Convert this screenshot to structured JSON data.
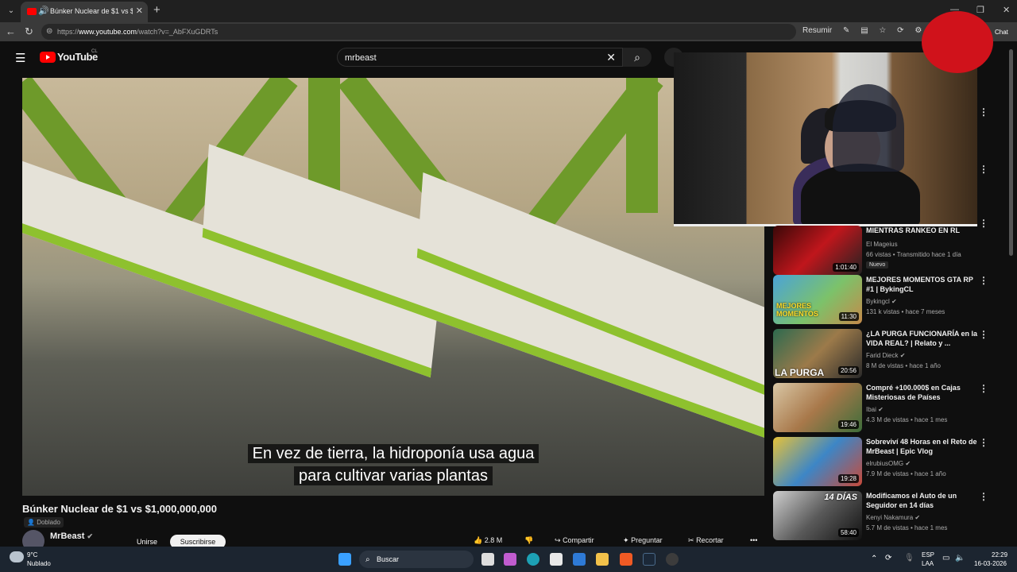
{
  "browser": {
    "tab_title": "Búnker Nuclear de $1 vs $1.0",
    "url_prefix": "https://",
    "url_host": "www.youtube.com",
    "url_path": "/watch?v=_AbFXuGDRTs",
    "resumir_label": "Resumir",
    "chat_label": "Chat"
  },
  "youtube": {
    "brand": "YouTube",
    "country": "CL",
    "search_query": "mrbeast"
  },
  "video": {
    "caption_line1": "En vez de tierra, la hidroponía usa agua",
    "caption_line2": "para cultivar varias plantas",
    "title": "Búnker Nuclear de $1 vs $1,000,000,000",
    "dub_label": "Doblado",
    "channel": "MrBeast",
    "join_label": "Unirse",
    "subscribe_label": "Suscribirse",
    "likes": "2.8 M",
    "share_label": "Compartir",
    "ask_label": "Preguntar",
    "clip_label": "Recortar"
  },
  "recommendations": [
    {
      "title": "MIENTRAS RANKEO EN RL",
      "channel": "El Mageius",
      "meta": "66 vistas • Transmitido hace 1 día",
      "badge": "Nuevo",
      "duration": "1:01:40"
    },
    {
      "title": "MEJORES MOMENTOS GTA RP #1 | BykingCL",
      "channel": "Bykingcl",
      "meta": "131 k vistas • hace 7 meses",
      "duration": "11:30"
    },
    {
      "title": "¿LA PURGA FUNCIONARÍA en la VIDA REAL? | Relato y ...",
      "channel": "Farid Dieck",
      "meta": "8 M de vistas • hace 1 año",
      "duration": "20:56"
    },
    {
      "title": "Compré +100.000$ en Cajas Misteriosas de Países",
      "channel": "Ibai",
      "meta": "4.3 M de vistas • hace 1 mes",
      "duration": "19:46"
    },
    {
      "title": "Sobreviví 48 Horas en el Reto de MrBeast | Epic Vlog",
      "channel": "elrubiusOMG",
      "meta": "7.9 M de vistas • hace 1 año",
      "duration": "19:28"
    },
    {
      "title": "Modificamos el Auto de un Seguidor en 14 días",
      "channel": "Kenyi Nakamura",
      "meta": "5.7 M de vistas • hace 1 mes",
      "duration": "58:40"
    }
  ],
  "thumb_text": {
    "momentos": "MEJORES MOMENTOS",
    "purga": "LA PURGA",
    "dias": "14 DÍAS"
  },
  "taskbar": {
    "temp": "9°C",
    "weather": "Nublado",
    "search_label": "Buscar",
    "lang1": "ESP",
    "lang2": "LAA",
    "time": "22:29",
    "date": "16-03-2026"
  },
  "colors": {
    "yt_red": "#ff0000",
    "green_tray": "#8ec12e",
    "bg": "#0f0f0f"
  }
}
